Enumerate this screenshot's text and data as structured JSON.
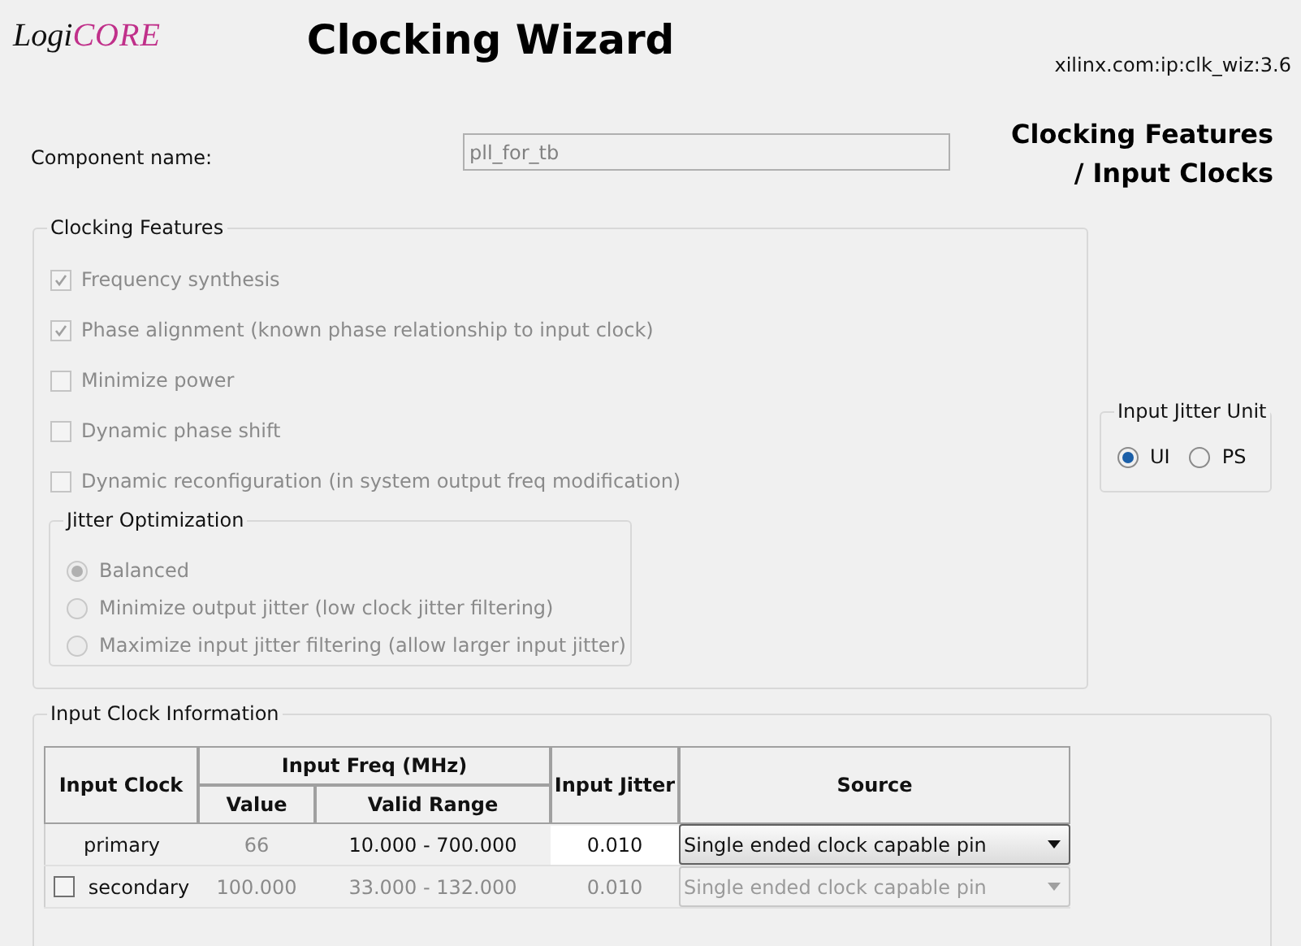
{
  "header": {
    "logo": {
      "prefix": "Logi",
      "suffix": "CORE"
    },
    "title": "Clocking Wizard",
    "version": "xilinx.com:ip:clk_wiz:3.6"
  },
  "component_name": {
    "label": "Component name:",
    "value": "pll_for_tb",
    "disabled": true
  },
  "page_title": {
    "line_1": "Clocking Features",
    "line_2": "/ Input Clocks"
  },
  "clocking_features": {
    "title": "Clocking Features",
    "items": [
      {
        "label": "Frequency synthesis",
        "checked": true,
        "disabled": true
      },
      {
        "label": "Phase alignment (known phase relationship to input clock)",
        "checked": true,
        "disabled": true
      },
      {
        "label": "Minimize power",
        "checked": false,
        "disabled": true
      },
      {
        "label": "Dynamic phase shift",
        "checked": false,
        "disabled": true
      },
      {
        "label": "Dynamic reconfiguration (in system output freq modification)",
        "checked": false,
        "disabled": true
      }
    ],
    "jitter_optimization": {
      "title": "Jitter Optimization",
      "options": [
        {
          "label": "Balanced",
          "selected": true,
          "disabled": true
        },
        {
          "label": "Minimize output jitter (low clock jitter filtering)",
          "selected": false,
          "disabled": true
        },
        {
          "label": "Maximize input jitter filtering (allow larger input jitter)",
          "selected": false,
          "disabled": true
        }
      ]
    }
  },
  "input_jitter_unit": {
    "title": "Input Jitter Unit",
    "options": [
      {
        "label": "UI",
        "selected": true,
        "disabled": false
      },
      {
        "label": "PS",
        "selected": false,
        "disabled": false
      }
    ]
  },
  "input_clock_information": {
    "title": "Input Clock Information",
    "table": {
      "columns": {
        "input_clock": "Input Clock",
        "input_freq": "Input Freq (MHz)",
        "value": "Value",
        "valid_range": "Valid Range",
        "input_jitter": "Input Jitter",
        "source": "Source"
      },
      "rows": [
        {
          "kind": "fixed",
          "name": "primary",
          "value": "66",
          "valid_range": "10.000 - 700.000",
          "input_jitter": "0.010",
          "source": "Single ended clock capable pin",
          "enabled": true
        },
        {
          "kind": "optional",
          "name": "secondary",
          "checked": false,
          "value": "100.000",
          "valid_range": "33.000 - 132.000",
          "input_jitter": "0.010",
          "source": "Single ended clock capable pin",
          "enabled": false
        }
      ]
    }
  }
}
